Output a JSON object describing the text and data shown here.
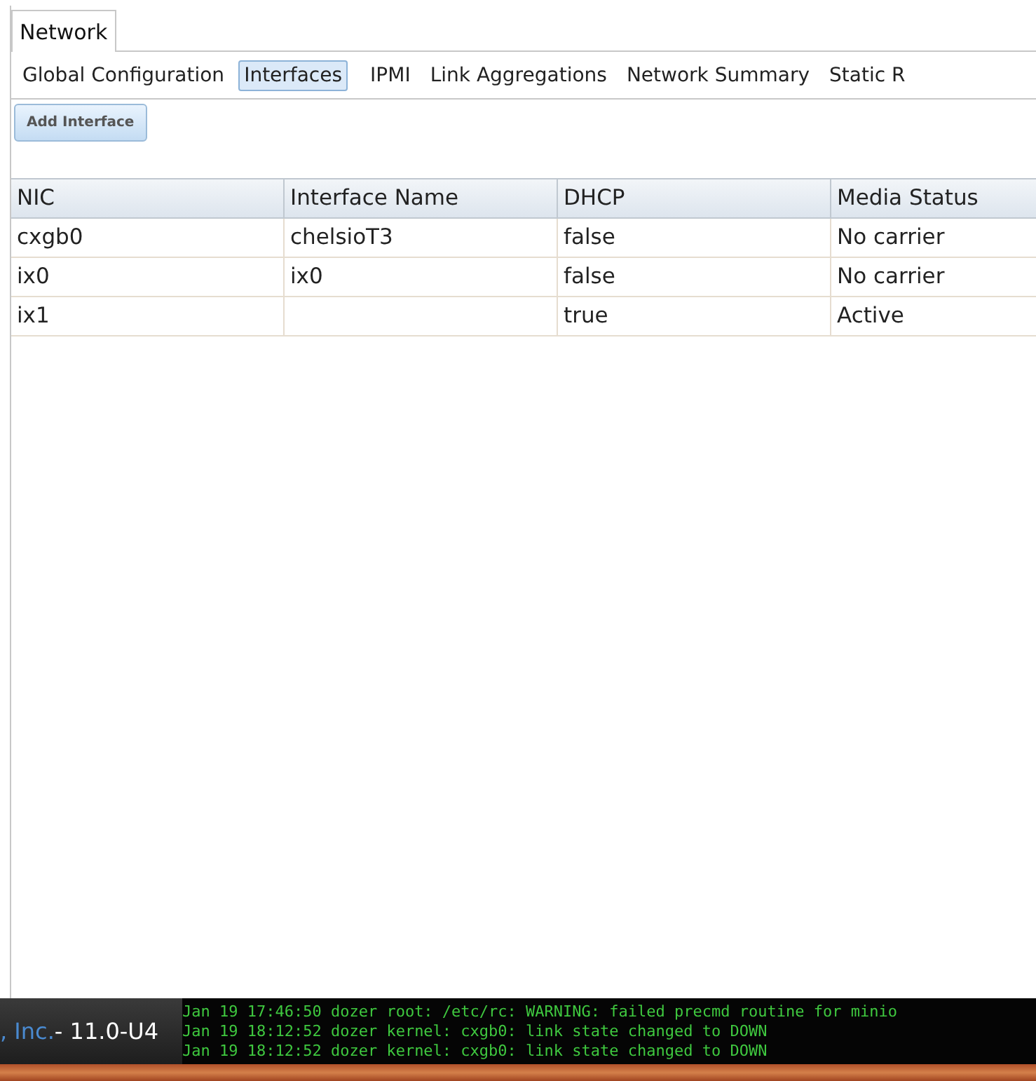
{
  "tabs": [
    {
      "label": "Network",
      "selected": true
    }
  ],
  "subtabs": [
    {
      "label": "Global Configuration",
      "selected": false
    },
    {
      "label": "Interfaces",
      "selected": true
    },
    {
      "label": "IPMI",
      "selected": false
    },
    {
      "label": "Link Aggregations",
      "selected": false
    },
    {
      "label": "Network Summary",
      "selected": false
    },
    {
      "label": "Static R",
      "selected": false
    }
  ],
  "toolbar": {
    "add_button": "Add Interface"
  },
  "table": {
    "columns": [
      "NIC",
      "Interface Name",
      "DHCP",
      "Media Status"
    ],
    "rows": [
      [
        "cxgb0",
        "chelsioT3",
        "false",
        "No carrier"
      ],
      [
        "ix0",
        "ix0",
        "false",
        "No carrier"
      ],
      [
        "ix1",
        "",
        "true",
        "Active"
      ]
    ]
  },
  "footer": {
    "company": ", Inc.",
    "version": "- 11.0-U4"
  },
  "console": [
    "Jan 19 17:46:50 dozer root: /etc/rc: WARNING: failed precmd routine for minio",
    "Jan 19 18:12:52 dozer kernel: cxgb0: link state changed to DOWN",
    "Jan 19 18:12:52 dozer kernel: cxgb0: link state changed to DOWN"
  ]
}
